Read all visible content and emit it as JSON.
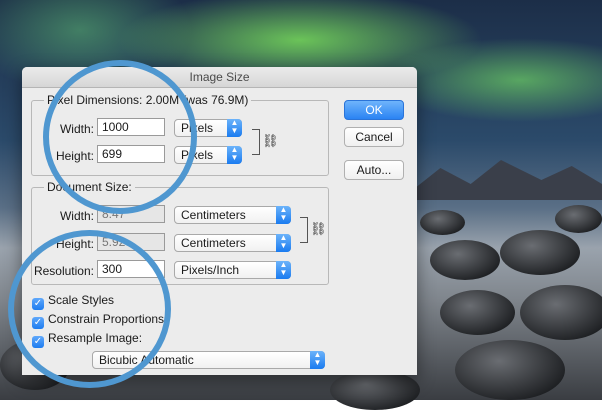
{
  "dialog": {
    "title": "Image Size"
  },
  "pixel_dimensions": {
    "legend": "Pixel Dimensions:",
    "size_text": "2.00M (was 76.9M)",
    "width": {
      "label": "Width:",
      "value": "1000",
      "unit": "Pixels"
    },
    "height": {
      "label": "Height:",
      "value": "699",
      "unit": "Pixels"
    }
  },
  "document_size": {
    "legend": "Document Size:",
    "width": {
      "label": "Width:",
      "value": "8.47",
      "unit": "Centimeters"
    },
    "height": {
      "label": "Height:",
      "value": "5.92",
      "unit": "Centimeters"
    },
    "resolution": {
      "label": "Resolution:",
      "value": "300",
      "unit": "Pixels/Inch"
    }
  },
  "options": {
    "scale_styles": {
      "label": "Scale Styles",
      "checked": true
    },
    "constrain_proportions": {
      "label": "Constrain Proportions",
      "checked": true
    },
    "resample_image": {
      "label": "Resample Image:",
      "checked": true
    },
    "resample_method": "Bicubic Automatic"
  },
  "buttons": {
    "ok": "OK",
    "cancel": "Cancel",
    "auto": "Auto..."
  },
  "icons": {
    "link": "chain-link-icon",
    "check": "✓"
  },
  "colors": {
    "highlight_ring": "#4f97d0",
    "default_button": "#2a83f3"
  }
}
